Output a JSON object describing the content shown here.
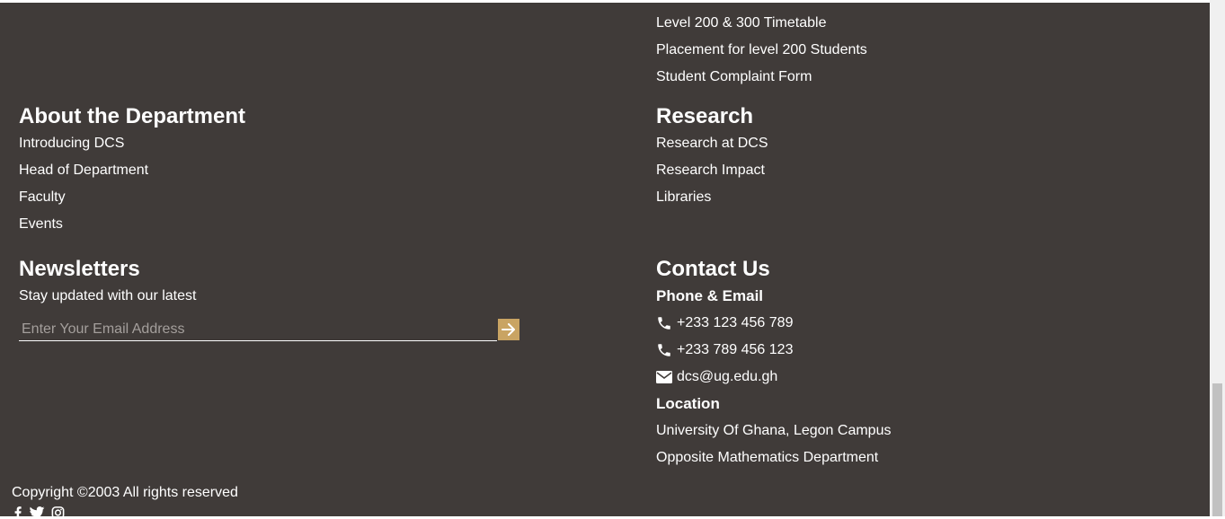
{
  "student_links": [
    "Level 200 & 300 Timetable",
    "Placement for level 200 Students",
    "Student Complaint Form"
  ],
  "about": {
    "heading": "About the Department",
    "links": [
      "Introducing DCS",
      "Head of Department",
      "Faculty",
      "Events"
    ]
  },
  "research": {
    "heading": "Research",
    "links": [
      "Research at DCS",
      "Research Impact",
      "Libraries"
    ]
  },
  "newsletter": {
    "heading": "Newsletters",
    "text": "Stay updated with our latest",
    "placeholder": "Enter Your Email Address",
    "submit_icon": "arrow-right-icon"
  },
  "contact": {
    "heading": "Contact Us",
    "phone_email_label": "Phone & Email",
    "phone1": "+233 123 456 789",
    "phone2": "+233 789 456 123",
    "email": "dcs@ug.edu.gh",
    "location_label": "Location",
    "location_line1": "University Of Ghana, Legon Campus",
    "location_line2": "Opposite Mathematics Department"
  },
  "copyright": "Copyright ©2003 All rights reserved",
  "social_icons": [
    "facebook-icon",
    "twitter-icon",
    "instagram-icon"
  ],
  "colors": {
    "footer_bg": "#403b39",
    "accent": "#c9a463",
    "text": "#ffffff"
  }
}
